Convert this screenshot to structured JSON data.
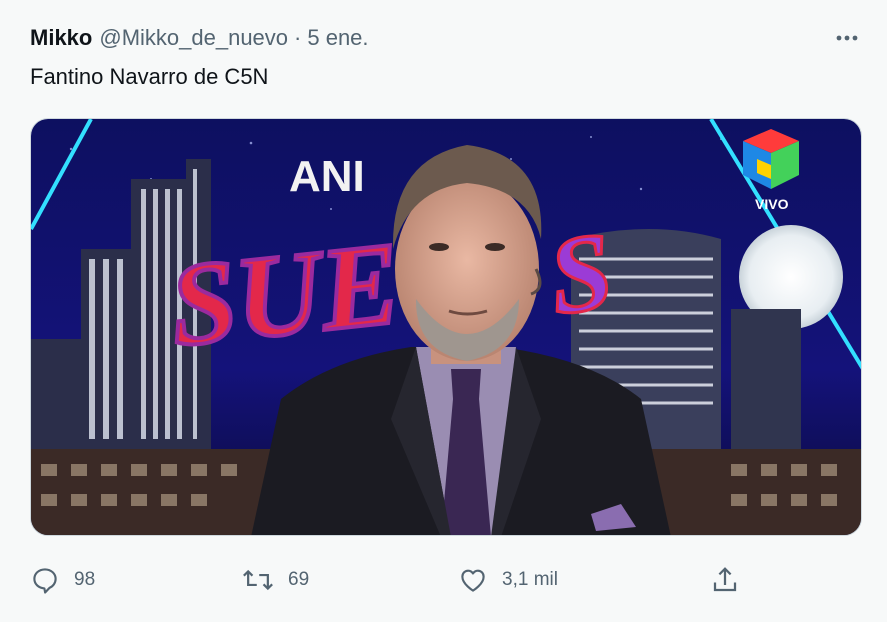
{
  "tweet": {
    "author_name": "Mikko",
    "handle": "@Mikko_de_nuevo",
    "separator": "·",
    "date": "5 ene.",
    "text": "Fantino Navarro de C5N"
  },
  "media": {
    "description_icon": "tv-show-photo",
    "overlay_texts": [
      "ANI",
      "SUE",
      "S",
      "VIVO"
    ]
  },
  "actions": {
    "reply_count": "98",
    "retweet_count": "69",
    "like_count": "3,1 mil"
  },
  "icons": {
    "more": "more-horizontal-icon",
    "reply": "reply-icon",
    "retweet": "retweet-icon",
    "like": "heart-icon",
    "share": "share-icon"
  },
  "colors": {
    "background": "#f7f9f9",
    "text": "#0f1419",
    "muted": "#536471"
  }
}
